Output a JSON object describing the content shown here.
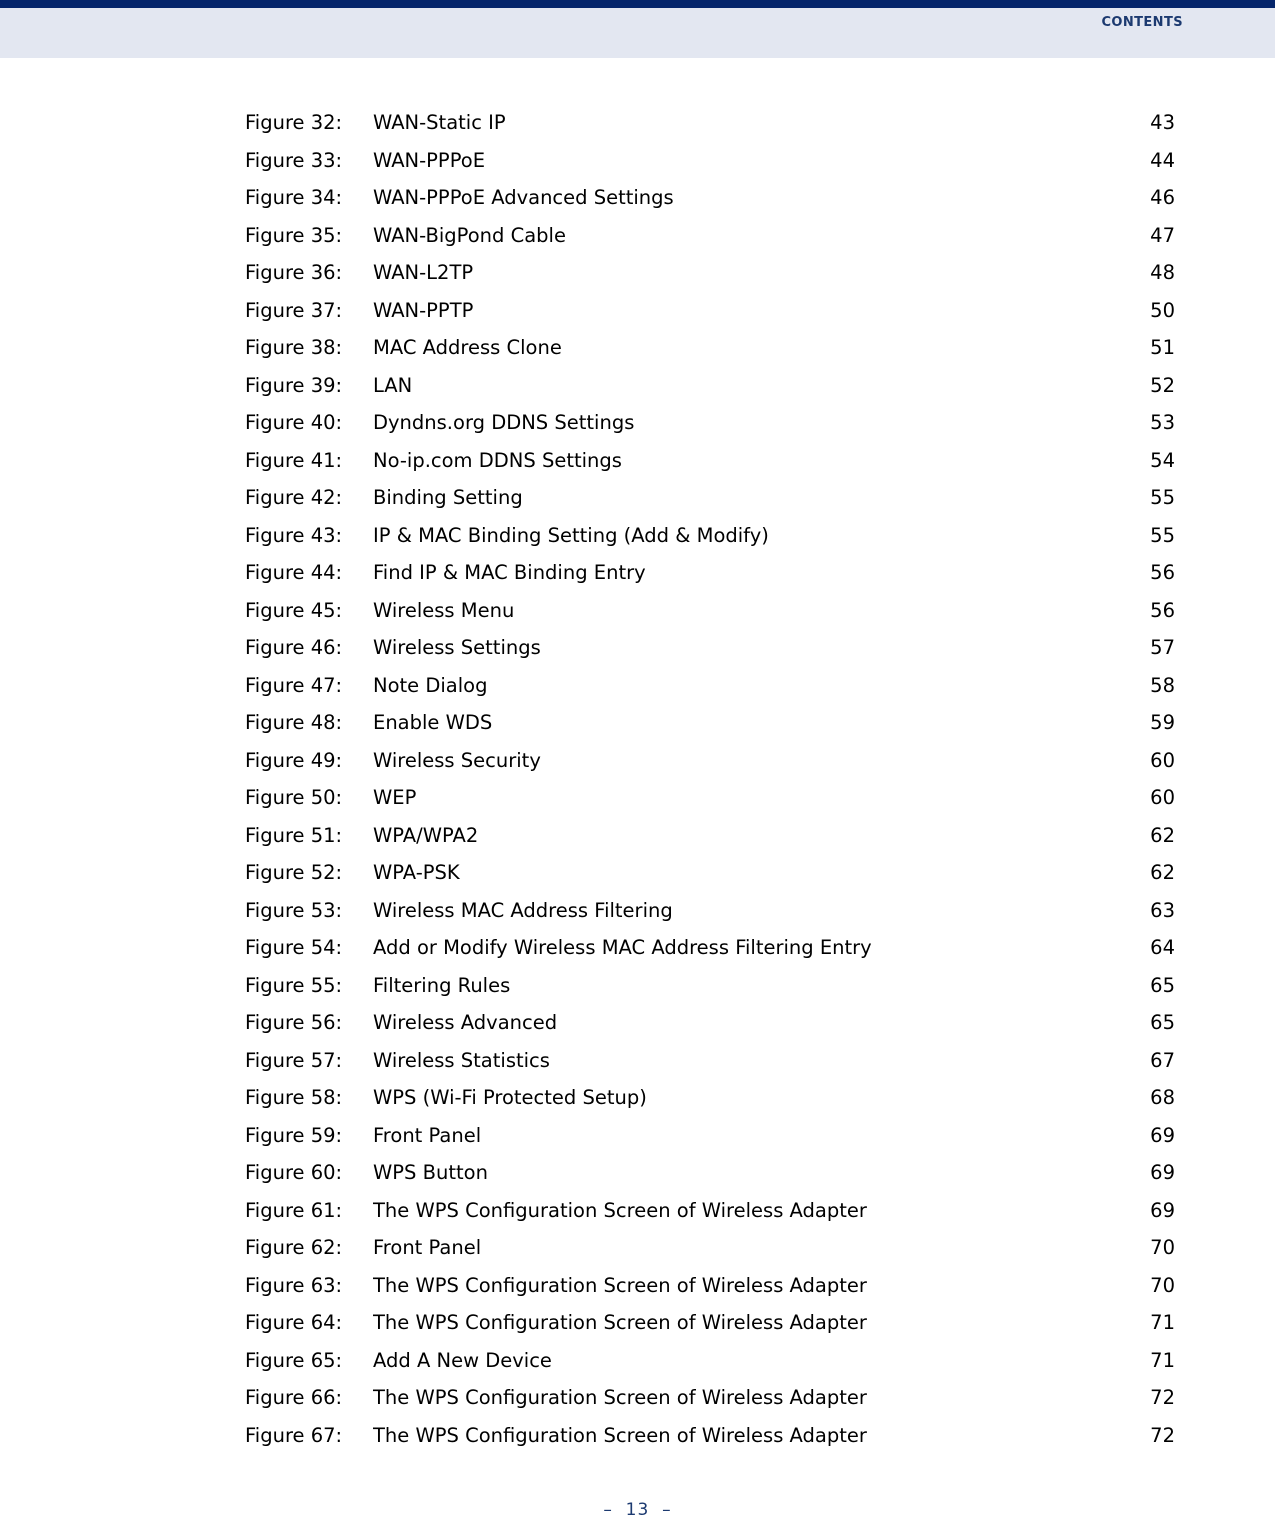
{
  "header": {
    "title": "Contents",
    "rule_color": "#05256b",
    "band_color": "#e3e7f1",
    "title_color": "#1c3a70"
  },
  "footer": {
    "page_marker": "–  13  –",
    "color": "#1c3a70"
  },
  "toc": {
    "entries": [
      {
        "label": "Figure 32:",
        "title": "WAN-Static IP",
        "page": "43"
      },
      {
        "label": "Figure 33:",
        "title": "WAN-PPPoE",
        "page": "44"
      },
      {
        "label": "Figure 34:",
        "title": "WAN-PPPoE Advanced Settings",
        "page": "46"
      },
      {
        "label": "Figure 35:",
        "title": "WAN-BigPond Cable",
        "page": "47"
      },
      {
        "label": "Figure 36:",
        "title": "WAN-L2TP",
        "page": "48"
      },
      {
        "label": "Figure 37:",
        "title": "WAN-PPTP",
        "page": "50"
      },
      {
        "label": "Figure 38:",
        "title": "MAC Address Clone",
        "page": "51"
      },
      {
        "label": "Figure 39:",
        "title": "LAN",
        "page": "52"
      },
      {
        "label": "Figure 40:",
        "title": "Dyndns.org DDNS Settings",
        "page": "53"
      },
      {
        "label": "Figure 41:",
        "title": "No-ip.com DDNS Settings",
        "page": "54"
      },
      {
        "label": "Figure 42:",
        "title": "Binding Setting",
        "page": "55"
      },
      {
        "label": "Figure 43:",
        "title": "IP & MAC Binding Setting (Add & Modify)",
        "page": "55"
      },
      {
        "label": "Figure 44:",
        "title": "Find IP & MAC Binding Entry",
        "page": "56"
      },
      {
        "label": "Figure 45:",
        "title": "Wireless Menu",
        "page": "56"
      },
      {
        "label": "Figure 46:",
        "title": "Wireless Settings",
        "page": "57"
      },
      {
        "label": "Figure 47:",
        "title": "Note Dialog",
        "page": "58"
      },
      {
        "label": "Figure 48:",
        "title": "Enable WDS",
        "page": "59"
      },
      {
        "label": "Figure 49:",
        "title": "Wireless Security",
        "page": "60"
      },
      {
        "label": "Figure 50:",
        "title": "WEP",
        "page": "60"
      },
      {
        "label": "Figure 51:",
        "title": "WPA/WPA2",
        "page": "62"
      },
      {
        "label": "Figure 52:",
        "title": "WPA-PSK",
        "page": "62"
      },
      {
        "label": "Figure 53:",
        "title": "Wireless MAC Address Filtering",
        "page": "63"
      },
      {
        "label": "Figure 54:",
        "title": "Add or Modify Wireless MAC Address Filtering Entry",
        "page": "64"
      },
      {
        "label": "Figure 55:",
        "title": "Filtering Rules",
        "page": "65"
      },
      {
        "label": "Figure 56:",
        "title": "Wireless Advanced",
        "page": "65"
      },
      {
        "label": "Figure 57:",
        "title": "Wireless Statistics",
        "page": "67"
      },
      {
        "label": "Figure 58:",
        "title": "WPS (Wi-Fi Protected Setup)",
        "page": "68"
      },
      {
        "label": "Figure 59:",
        "title": "Front Panel",
        "page": "69"
      },
      {
        "label": "Figure 60:",
        "title": "WPS Button",
        "page": "69"
      },
      {
        "label": "Figure 61:",
        "title": "The WPS Configuration Screen of Wireless Adapter",
        "page": "69"
      },
      {
        "label": "Figure 62:",
        "title": "Front Panel",
        "page": "70"
      },
      {
        "label": "Figure 63:",
        "title": "The WPS Configuration Screen of Wireless Adapter",
        "page": "70"
      },
      {
        "label": "Figure 64:",
        "title": "The WPS Configuration Screen of Wireless Adapter",
        "page": "71"
      },
      {
        "label": "Figure 65:",
        "title": "Add A New Device",
        "page": "71"
      },
      {
        "label": "Figure 66:",
        "title": "The WPS Configuration Screen of Wireless Adapter",
        "page": "72"
      },
      {
        "label": "Figure 67:",
        "title": "The WPS Configuration Screen of Wireless Adapter",
        "page": "72"
      }
    ]
  }
}
